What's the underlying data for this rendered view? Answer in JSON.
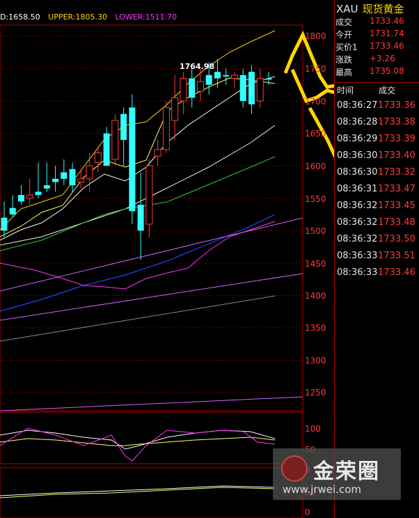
{
  "indicator": {
    "mid_label": "D:1658.50",
    "upper_label": "UPPER:1805.30",
    "lower_label": "LOWER:1511.70",
    "colors": {
      "mid": "#ffffff",
      "upper": "#ffd700",
      "lower": "#ff33ff"
    }
  },
  "annotation": {
    "high_label": "1764.98"
  },
  "chart_data": {
    "type": "candlestick",
    "y_ticks": [
      "1800",
      "1750",
      "1700",
      "1650",
      "1600",
      "1550",
      "1500",
      "1450",
      "1400",
      "1350",
      "1300",
      "1250"
    ],
    "ylim": [
      1225,
      1825
    ],
    "candles": [
      {
        "o": 1520,
        "h": 1545,
        "l": 1490,
        "c": 1500
      },
      {
        "o": 1535,
        "h": 1555,
        "l": 1520,
        "c": 1525
      },
      {
        "o": 1555,
        "h": 1570,
        "l": 1540,
        "c": 1545
      },
      {
        "o": 1550,
        "h": 1580,
        "l": 1540,
        "c": 1555
      },
      {
        "o": 1560,
        "h": 1605,
        "l": 1550,
        "c": 1555
      },
      {
        "o": 1570,
        "h": 1605,
        "l": 1560,
        "c": 1565
      },
      {
        "o": 1580,
        "h": 1600,
        "l": 1560,
        "c": 1575
      },
      {
        "o": 1590,
        "h": 1610,
        "l": 1570,
        "c": 1580
      },
      {
        "o": 1595,
        "h": 1605,
        "l": 1560,
        "c": 1570
      },
      {
        "o": 1575,
        "h": 1595,
        "l": 1565,
        "c": 1580
      },
      {
        "o": 1580,
        "h": 1620,
        "l": 1560,
        "c": 1600
      },
      {
        "o": 1605,
        "h": 1630,
        "l": 1590,
        "c": 1620
      },
      {
        "o": 1650,
        "h": 1660,
        "l": 1600,
        "c": 1600
      },
      {
        "o": 1610,
        "h": 1680,
        "l": 1600,
        "c": 1670
      },
      {
        "o": 1680,
        "h": 1690,
        "l": 1600,
        "c": 1640
      },
      {
        "o": 1690,
        "h": 1710,
        "l": 1510,
        "c": 1530
      },
      {
        "o": 1540,
        "h": 1590,
        "l": 1455,
        "c": 1500
      },
      {
        "o": 1510,
        "h": 1610,
        "l": 1490,
        "c": 1600
      },
      {
        "o": 1615,
        "h": 1640,
        "l": 1600,
        "c": 1625
      },
      {
        "o": 1625,
        "h": 1700,
        "l": 1620,
        "c": 1690
      },
      {
        "o": 1670,
        "h": 1740,
        "l": 1640,
        "c": 1705
      },
      {
        "o": 1700,
        "h": 1745,
        "l": 1680,
        "c": 1735
      },
      {
        "o": 1735,
        "h": 1750,
        "l": 1690,
        "c": 1705
      },
      {
        "o": 1715,
        "h": 1750,
        "l": 1700,
        "c": 1730
      },
      {
        "o": 1740,
        "h": 1760,
        "l": 1710,
        "c": 1725
      },
      {
        "o": 1745,
        "h": 1765,
        "l": 1720,
        "c": 1735
      },
      {
        "o": 1740,
        "h": 1750,
        "l": 1725,
        "c": 1738
      },
      {
        "o": 1735,
        "h": 1745,
        "l": 1720,
        "c": 1740
      },
      {
        "o": 1740,
        "h": 1750,
        "l": 1690,
        "c": 1700
      },
      {
        "o": 1745,
        "h": 1755,
        "l": 1680,
        "c": 1695
      },
      {
        "o": 1700,
        "h": 1750,
        "l": 1690,
        "c": 1735
      },
      {
        "o": 1735,
        "h": 1745,
        "l": 1725,
        "c": 1733
      }
    ],
    "subpanel1_ticks": [
      "100",
      "50",
      "0"
    ],
    "subpanel2_ticks": [
      "50",
      "0"
    ],
    "colors": {
      "up": "#ff3b3b",
      "down": "#33ffff"
    }
  },
  "quote": {
    "symbol": "XAU",
    "name": "现货黄金",
    "rows": [
      {
        "label": "成交",
        "value": "1733.46"
      },
      {
        "label": "今开",
        "value": "1731.74"
      },
      {
        "label": "买价1",
        "value": "1733.46"
      },
      {
        "label": "涨跌",
        "value": "+3.26"
      },
      {
        "label": "最高",
        "value": "1735.08"
      }
    ],
    "tick_header": {
      "time": "时间",
      "price": "成交"
    },
    "ticks": [
      {
        "time": "08:36:27",
        "price": "1733.36"
      },
      {
        "time": "08:36:28",
        "price": "1733.38"
      },
      {
        "time": "08:36:29",
        "price": "1733.39"
      },
      {
        "time": "08:36:30",
        "price": "1733.40"
      },
      {
        "time": "08:36:30",
        "price": "1733.32"
      },
      {
        "time": "08:36:31",
        "price": "1733.47"
      },
      {
        "time": "08:36:32",
        "price": "1733.45"
      },
      {
        "time": "08:36:32",
        "price": "1733.48"
      },
      {
        "time": "08:36:32",
        "price": "1733.50"
      },
      {
        "time": "08:36:33",
        "price": "1733.51"
      },
      {
        "time": "08:36:33",
        "price": "1733.46"
      }
    ]
  },
  "watermark": {
    "brand": "金荣圈",
    "url": "www.jrwei.com"
  }
}
